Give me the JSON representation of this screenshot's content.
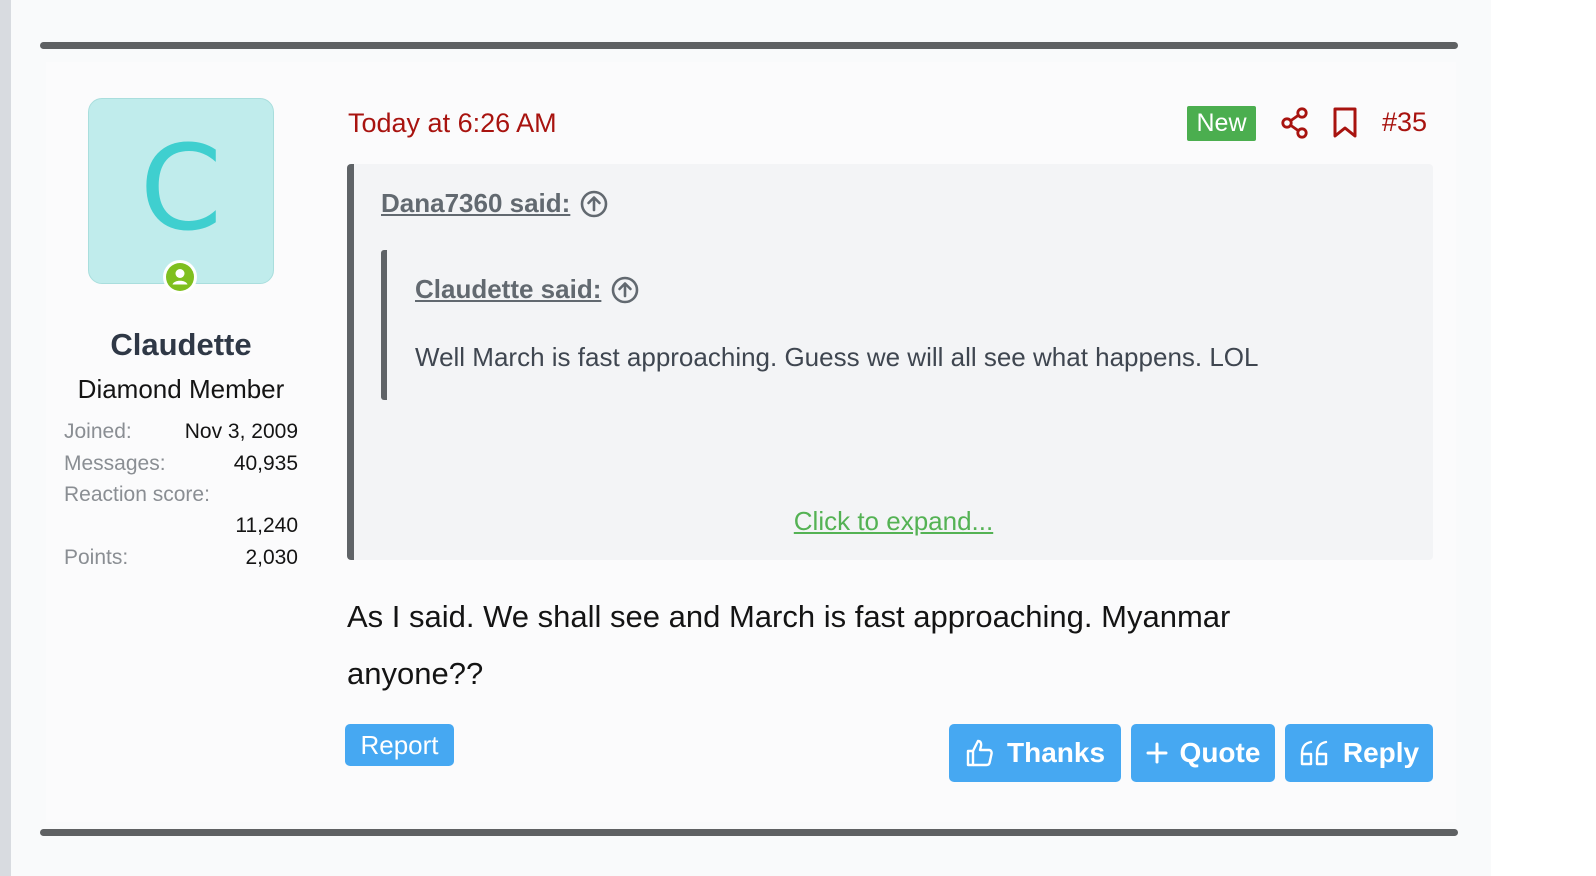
{
  "user": {
    "avatar_letter": "C",
    "name": "Claudette",
    "title": "Diamond Member",
    "stats": {
      "joined_label": "Joined:",
      "joined_value": "Nov 3, 2009",
      "messages_label": "Messages:",
      "messages_value": "40,935",
      "reaction_label": "Reaction score:",
      "reaction_value": "11,240",
      "points_label": "Points:",
      "points_value": "2,030"
    }
  },
  "post": {
    "date": "Today at 6:26 AM",
    "badge": "New",
    "number": "#35",
    "quote_outer_author": "Dana7360 said:",
    "quote_inner_author": "Claudette said:",
    "quote_inner_text": "Well March is fast approaching. Guess we will all see what happens. LOL",
    "expand_link": "Click to expand...",
    "body_line1": "As I said. We shall see and March is fast approaching. Myanmar",
    "body_line2": "anyone??"
  },
  "actions": {
    "report": "Report",
    "thanks": "Thanks",
    "quote": "Quote",
    "reply": "Reply"
  },
  "colors": {
    "accent_red": "#a8130f",
    "new_badge": "#4bae4f",
    "button_blue": "#46a8f2",
    "link_green": "#54b254",
    "avatar_bg": "#c0ecec",
    "avatar_letter": "#3fcfcf"
  }
}
